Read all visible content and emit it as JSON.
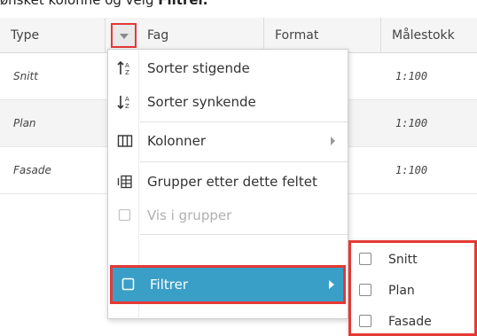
{
  "caption": {
    "text": "ønsket kolonne og velg ",
    "bold": "Filtrer."
  },
  "columns": [
    {
      "label": "Type"
    },
    {
      "label": "Fag"
    },
    {
      "label": "Format"
    },
    {
      "label": "Målestokk"
    }
  ],
  "rows": [
    {
      "type": "Snitt",
      "scale": "1:100"
    },
    {
      "type": "Plan",
      "scale": "1:100"
    },
    {
      "type": "Fasade",
      "scale": "1:100"
    }
  ],
  "menu": {
    "sort_asc": "Sorter stigende",
    "sort_desc": "Sorter synkende",
    "columns": "Kolonner",
    "group": "Grupper etter dette feltet",
    "show_groups": "Vis i grupper",
    "filter": "Filtrer"
  },
  "submenu": [
    "Snitt",
    "Plan",
    "Fasade"
  ],
  "colors": {
    "highlight": "#3a9fc7",
    "annotation": "#e53935"
  }
}
